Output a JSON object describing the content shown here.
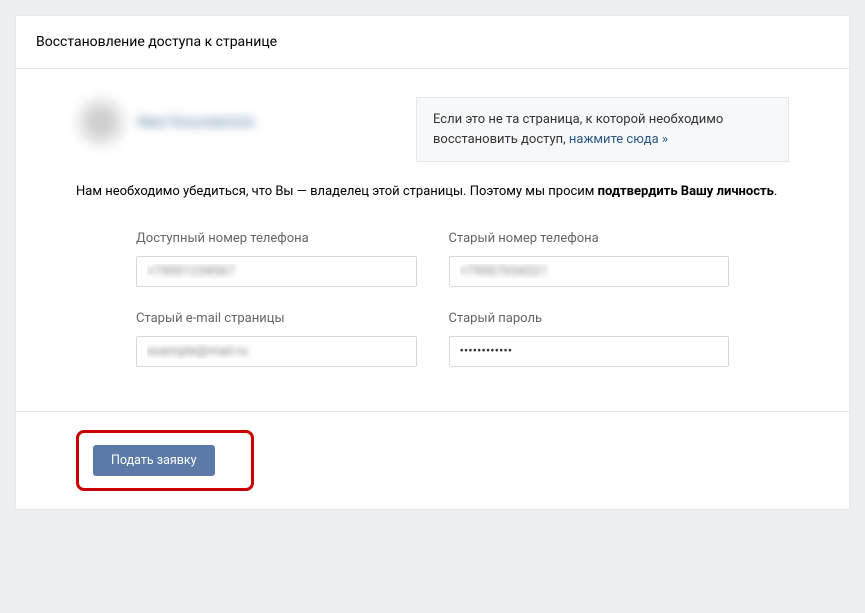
{
  "header": {
    "title": "Восстановление доступа к странице"
  },
  "profile": {
    "username": "Имя Пользователя"
  },
  "infobox": {
    "text_before": "Если это не та страница, к которой необходимо восстановить доступ, ",
    "link_text": "нажмите сюда »"
  },
  "description": {
    "text_before": "Нам необходимо убедиться, что Вы — владелец этой страницы. Поэтому мы просим ",
    "bold_text": "подтвердить Вашу личность",
    "text_after": "."
  },
  "form": {
    "available_phone": {
      "label": "Доступный номер телефона",
      "value": "+79001234567"
    },
    "old_phone": {
      "label": "Старый номер телефона",
      "value": "+79007654321"
    },
    "old_email": {
      "label": "Старый e-mail страницы",
      "value": "example@mail.ru"
    },
    "old_password": {
      "label": "Старый пароль",
      "value": "••••••••••••"
    }
  },
  "footer": {
    "submit_label": "Подать заявку"
  }
}
